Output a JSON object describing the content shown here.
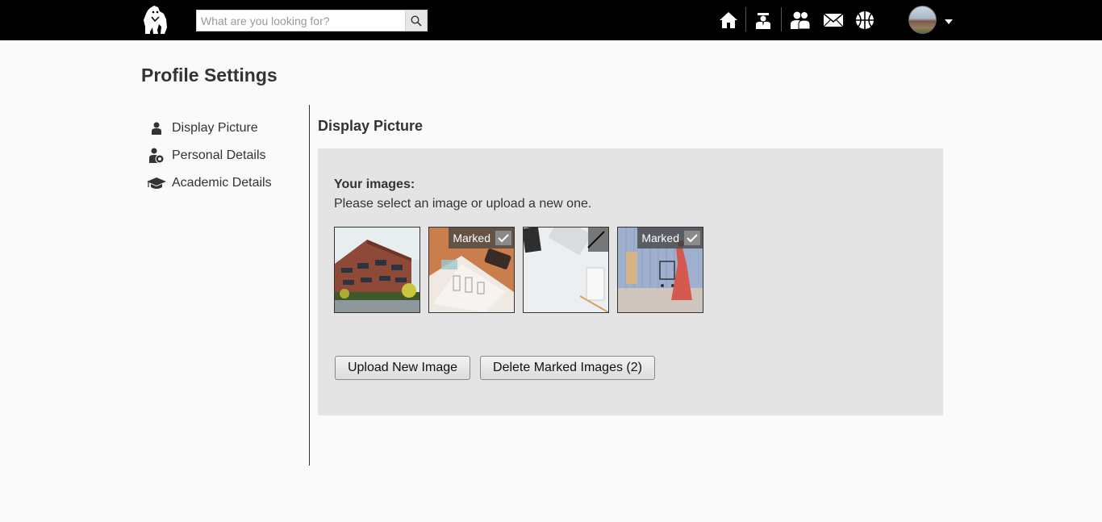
{
  "header": {
    "logo": "gorilla-logo",
    "search": {
      "placeholder": "What are you looking for?",
      "value": ""
    },
    "nav_icons": [
      "home-icon",
      "teacher-icon",
      "people-icon",
      "mail-icon",
      "basketball-icon"
    ],
    "avatar": "user-avatar"
  },
  "page": {
    "title": "Profile Settings"
  },
  "sidebar": {
    "items": [
      {
        "label": "Display Picture",
        "icon": "person-icon"
      },
      {
        "label": "Personal Details",
        "icon": "person-gear-icon"
      },
      {
        "label": "Academic Details",
        "icon": "graduation-cap-icon"
      }
    ]
  },
  "main": {
    "section_title": "Display Picture",
    "images_heading": "Your images:",
    "images_hint": "Please select an image or upload a new one.",
    "images": [
      {
        "subject": "modern brick building",
        "marked": false
      },
      {
        "subject": "desk with sketchbook and phone",
        "marked": true
      },
      {
        "subject": "white desk with keyboard and phone",
        "marked": false
      },
      {
        "subject": "woman in red dress with cart",
        "marked": true
      }
    ],
    "marked_label": "Marked",
    "buttons": {
      "upload": "Upload New Image",
      "delete_marked": "Delete Marked Images (2)"
    }
  },
  "colors": {
    "topbar": "#000000",
    "page_background": "#fafafa",
    "panel_background": "#e4e4e4",
    "text": "#333333"
  }
}
